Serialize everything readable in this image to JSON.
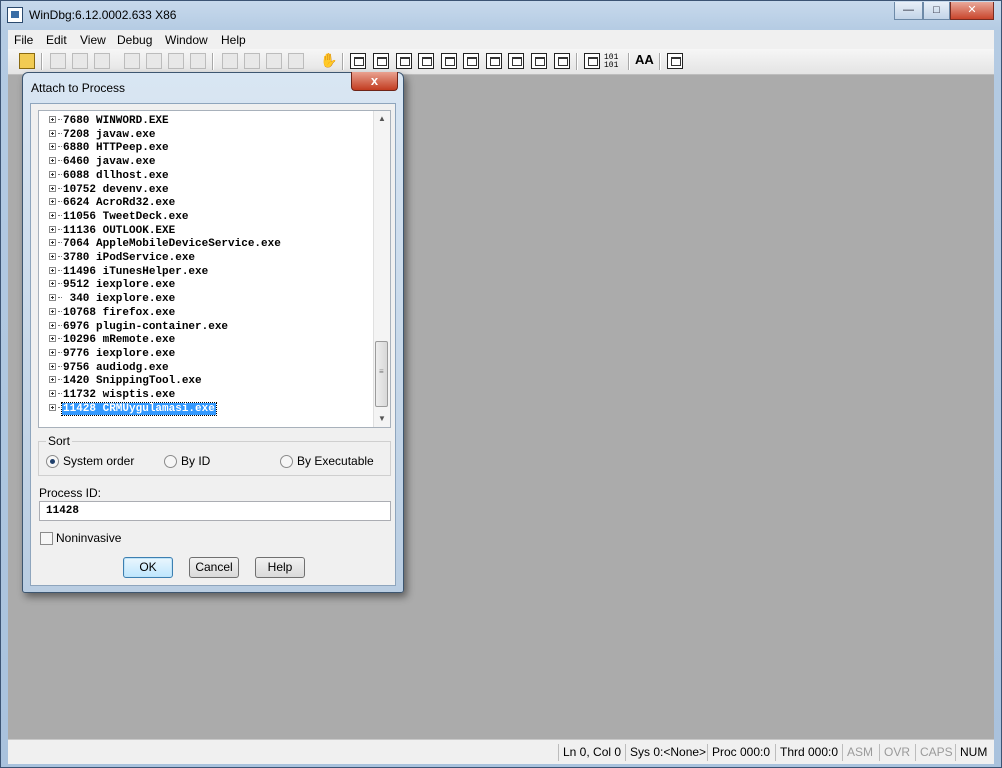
{
  "window": {
    "title": "WinDbg:6.12.0002.633 X86",
    "controls": {
      "minimize": "—",
      "maximize": "□",
      "close": "✕"
    }
  },
  "menu": [
    "File",
    "Edit",
    "View",
    "Debug",
    "Window",
    "Help"
  ],
  "toolbar": {
    "font_button_label": "AA",
    "hex_button_label": "101\n101",
    "icons": [
      "open-folder-icon",
      "cut-icon",
      "copy-icon",
      "paste-icon",
      "go-icon",
      "restart-icon",
      "stop-icon",
      "break-icon",
      "step-into-icon",
      "step-over-icon",
      "step-out-icon",
      "run-to-cursor-icon",
      "hand-icon",
      "command-window-icon",
      "watch-icon",
      "locals-icon",
      "registers-icon",
      "memory-icon",
      "call-stack-icon",
      "disassembly-icon",
      "scratch-pad-icon",
      "processes-threads-icon",
      "source-mode-icon",
      "hex-mode-icon",
      "font-icon",
      "options-icon"
    ]
  },
  "dialog": {
    "title": "Attach to Process",
    "close": "x",
    "processes": [
      {
        "pid": "7680",
        "name": "WINWORD.EXE"
      },
      {
        "pid": "7208",
        "name": "javaw.exe"
      },
      {
        "pid": "6880",
        "name": "HTTPeep.exe"
      },
      {
        "pid": "6460",
        "name": "javaw.exe"
      },
      {
        "pid": "6088",
        "name": "dllhost.exe"
      },
      {
        "pid": "10752",
        "name": "devenv.exe"
      },
      {
        "pid": "6624",
        "name": "AcroRd32.exe"
      },
      {
        "pid": "11056",
        "name": "TweetDeck.exe"
      },
      {
        "pid": "11136",
        "name": "OUTLOOK.EXE"
      },
      {
        "pid": "7064",
        "name": "AppleMobileDeviceService.exe"
      },
      {
        "pid": "3780",
        "name": "iPodService.exe"
      },
      {
        "pid": "11496",
        "name": "iTunesHelper.exe"
      },
      {
        "pid": "9512",
        "name": "iexplore.exe"
      },
      {
        "pid": " 340",
        "name": "iexplore.exe"
      },
      {
        "pid": "10768",
        "name": "firefox.exe"
      },
      {
        "pid": "6976",
        "name": "plugin-container.exe"
      },
      {
        "pid": "10296",
        "name": "mRemote.exe"
      },
      {
        "pid": "9776",
        "name": "iexplore.exe"
      },
      {
        "pid": "9756",
        "name": "audiodg.exe"
      },
      {
        "pid": "1420",
        "name": "SnippingTool.exe"
      },
      {
        "pid": "11732",
        "name": "wisptis.exe"
      },
      {
        "pid": "11428",
        "name": "CRMUygulamasi.exe"
      }
    ],
    "selected_pid": "11428",
    "sort": {
      "legend": "Sort",
      "options": [
        "System order",
        "By ID",
        "By Executable"
      ],
      "selected": "System order"
    },
    "process_id": {
      "label": "Process ID:",
      "value": "11428"
    },
    "noninvasive": {
      "label": "Noninvasive",
      "checked": false
    },
    "buttons": {
      "ok": "OK",
      "cancel": "Cancel",
      "help": "Help"
    }
  },
  "statusbar": {
    "line_col": "Ln 0, Col 0",
    "sys": "Sys 0:<None>",
    "proc": "Proc 000:0",
    "thrd": "Thrd 000:0",
    "asm": "ASM",
    "ovr": "OVR",
    "caps": "CAPS",
    "num": "NUM"
  }
}
